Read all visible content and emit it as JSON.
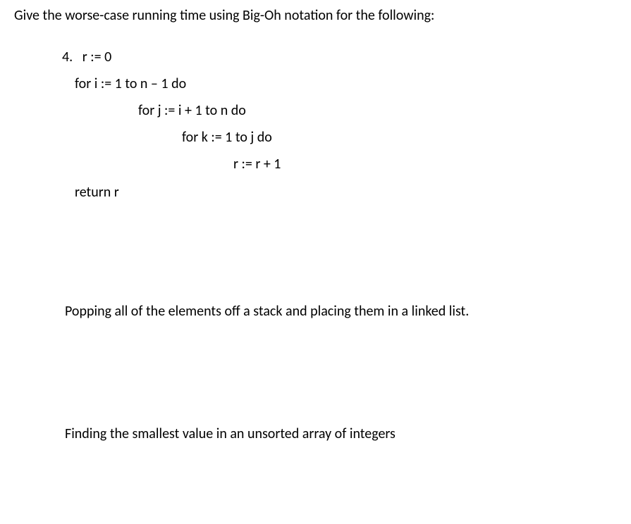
{
  "header": "Give the worse-case running time using Big-Oh notation for the following:",
  "problemNumber": "4.",
  "code": {
    "line1": "r := 0",
    "line2": "for i := 1 to n – 1 do",
    "line3": "for j := i + 1 to n do",
    "line4": "for k := 1 to j do",
    "line5": "r := r + 1",
    "line6": "return r"
  },
  "subQuestion1": "Popping all of the elements off a stack and placing them in a linked list.",
  "subQuestion2": "Finding the smallest value in an unsorted array of integers"
}
